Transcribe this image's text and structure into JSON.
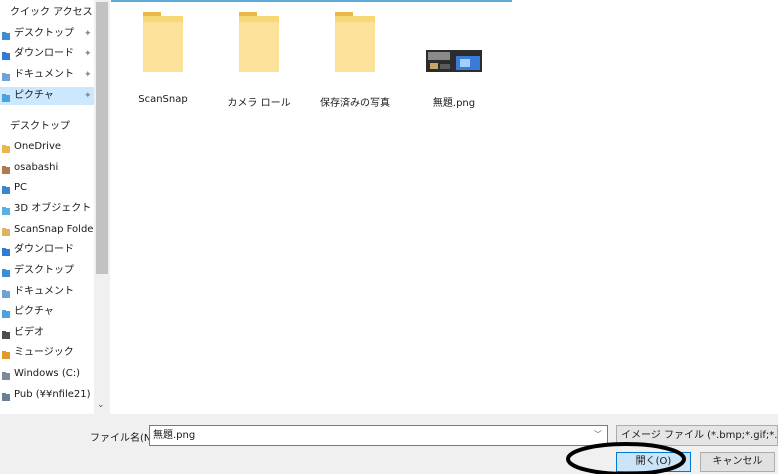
{
  "sidebar": {
    "items": [
      {
        "label": "クイック アクセス",
        "icon": "",
        "pinned": false
      },
      {
        "label": "デスクトップ",
        "icon": "desktop-folder-icon",
        "pinned": true
      },
      {
        "label": "ダウンロード",
        "icon": "download-folder-icon",
        "pinned": true
      },
      {
        "label": "ドキュメント",
        "icon": "documents-folder-icon",
        "pinned": true
      },
      {
        "label": "ピクチャ",
        "icon": "pictures-folder-icon",
        "pinned": true,
        "selected": true
      },
      {
        "label": "デスクトップ",
        "icon": "",
        "pinned": false
      },
      {
        "label": "OneDrive",
        "icon": "onedrive-folder-icon",
        "pinned": false
      },
      {
        "label": "osabashi",
        "icon": "user-icon",
        "pinned": false
      },
      {
        "label": "PC",
        "icon": "pc-icon",
        "pinned": false
      },
      {
        "label": "3D オブジェクト",
        "icon": "3d-objects-folder-icon",
        "pinned": false
      },
      {
        "label": "ScanSnap Folde",
        "icon": "scansnap-folder-icon",
        "pinned": false
      },
      {
        "label": "ダウンロード",
        "icon": "download-folder-icon",
        "pinned": false
      },
      {
        "label": "デスクトップ",
        "icon": "desktop-folder-icon",
        "pinned": false
      },
      {
        "label": "ドキュメント",
        "icon": "documents-folder-icon",
        "pinned": false
      },
      {
        "label": "ピクチャ",
        "icon": "pictures-folder-icon",
        "pinned": false
      },
      {
        "label": "ビデオ",
        "icon": "videos-folder-icon",
        "pinned": false
      },
      {
        "label": "ミュージック",
        "icon": "music-folder-icon",
        "pinned": false
      },
      {
        "label": "Windows (C:)",
        "icon": "drive-icon",
        "pinned": false
      },
      {
        "label": "Pub (¥¥nfile21)",
        "icon": "network-drive-icon",
        "pinned": false
      }
    ],
    "pin_glyph": "📌"
  },
  "files": [
    {
      "name": "ScanSnap",
      "type": "folder",
      "icon": "folder-icon"
    },
    {
      "name": "カメラ ロール",
      "type": "folder",
      "icon": "folder-icon"
    },
    {
      "name": "保存済みの写真",
      "type": "folder",
      "icon": "folder-icon"
    },
    {
      "name": "無題.png",
      "type": "image",
      "icon": "image-thumbnail"
    }
  ],
  "footer": {
    "filename_label": "ファイル名(N):",
    "filename_value": "無題.png",
    "filetype_value": "イメージ ファイル (*.bmp;*.gif;*.jfif;*",
    "open_label": "開く(O)",
    "cancel_label": "キャンセル"
  },
  "colors": {
    "selected_bg": "#cce8ff",
    "folder_yellow": "#f8d775",
    "open_button_bg": "#cce4f7",
    "open_button_border": "#0078d7"
  }
}
